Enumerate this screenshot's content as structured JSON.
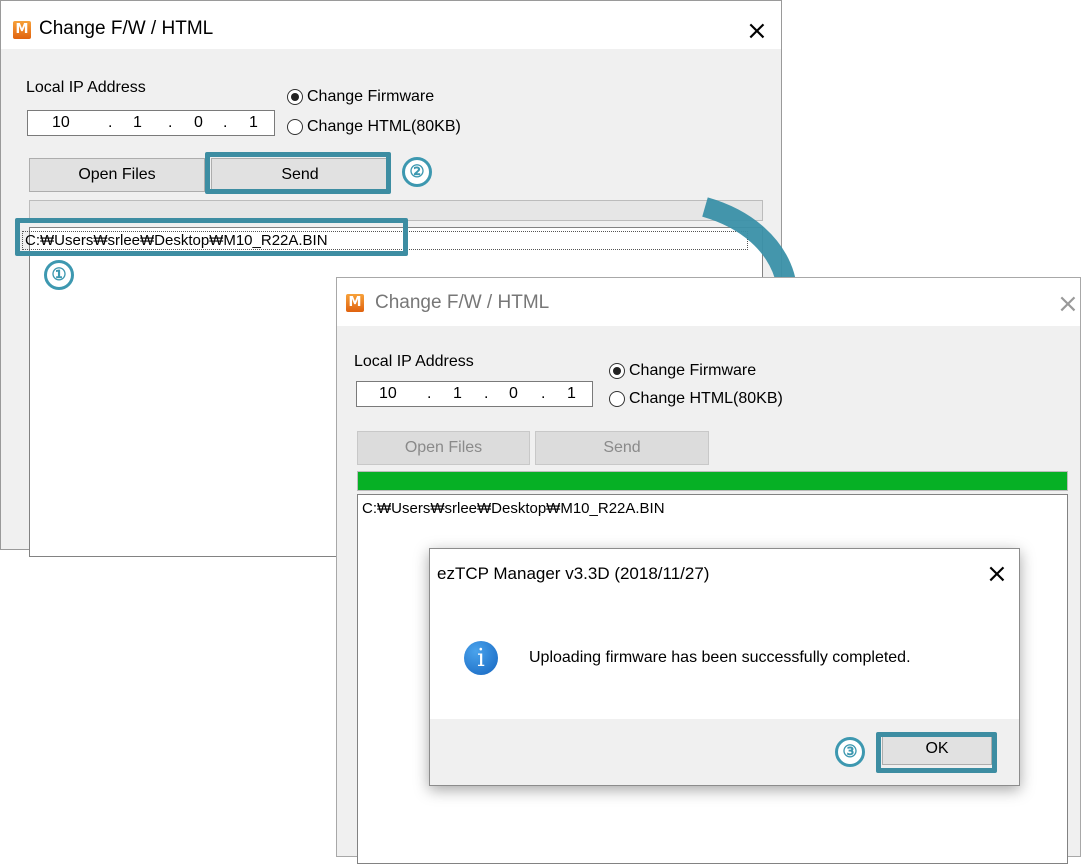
{
  "window_back": {
    "title": "Change F/W / HTML",
    "app_icon": "M",
    "ip_label": "Local IP Address",
    "ip": [
      "10",
      "1",
      "0",
      "1"
    ],
    "radio_firmware": "Change Firmware",
    "radio_html": "Change HTML(80KB)",
    "selected_radio": "firmware",
    "open_files_label": "Open Files",
    "send_label": "Send",
    "progress_fraction": 0,
    "file_path": "C:₩Users₩srlee₩Desktop₩M10_R22A.BIN"
  },
  "window_front": {
    "title": "Change F/W / HTML",
    "app_icon": "M",
    "ip_label": "Local IP Address",
    "ip": [
      "10",
      "1",
      "0",
      "1"
    ],
    "radio_firmware": "Change Firmware",
    "radio_html": "Change HTML(80KB)",
    "selected_radio": "firmware",
    "open_files_label": "Open Files",
    "send_label": "Send",
    "progress_fraction": 1.0,
    "file_path": "C:₩Users₩srlee₩Desktop₩M10_R22A.BIN"
  },
  "message_box": {
    "title": "ezTCP Manager v3.3D (2018/11/27)",
    "icon": "info-icon",
    "message": "Uploading firmware has been successfully completed.",
    "ok_label": "OK"
  },
  "steps": {
    "step1": "①",
    "step2": "②",
    "step3": "③"
  },
  "icons": {
    "close": "×",
    "info": "i"
  },
  "colors": {
    "highlight": "#3d8da2",
    "arrow": "#3a90a8",
    "progress": "#06b025",
    "info_icon": "#1e73d2"
  }
}
